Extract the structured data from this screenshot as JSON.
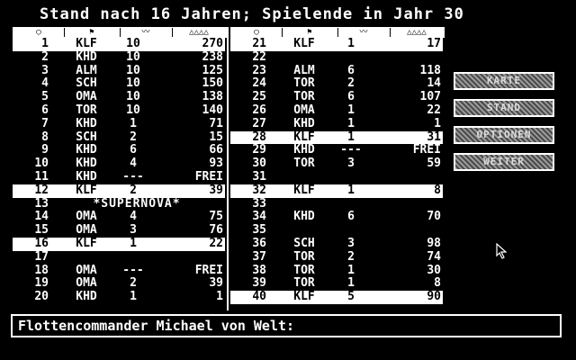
{
  "title": "Stand nach 16 Jahren; Spielende in Jahr 30",
  "header_icons": [
    "circle-icon",
    "flag-icon",
    "wave-icon",
    "triangles-icon"
  ],
  "left_rows": [
    {
      "num": "1",
      "owner": "KLF",
      "ships": "10",
      "prod": "270",
      "hl": true
    },
    {
      "num": "2",
      "owner": "KHD",
      "ships": "10",
      "prod": "238"
    },
    {
      "num": "3",
      "owner": "ALM",
      "ships": "10",
      "prod": "125"
    },
    {
      "num": "4",
      "owner": "SCH",
      "ships": "10",
      "prod": "150"
    },
    {
      "num": "5",
      "owner": "OMA",
      "ships": "10",
      "prod": "138"
    },
    {
      "num": "6",
      "owner": "TOR",
      "ships": "10",
      "prod": "140"
    },
    {
      "num": "7",
      "owner": "KHD",
      "ships": "1",
      "prod": "71"
    },
    {
      "num": "8",
      "owner": "SCH",
      "ships": "2",
      "prod": "15"
    },
    {
      "num": "9",
      "owner": "KHD",
      "ships": "6",
      "prod": "66"
    },
    {
      "num": "10",
      "owner": "KHD",
      "ships": "4",
      "prod": "93"
    },
    {
      "num": "11",
      "owner": "KHD",
      "ships": "---",
      "prod": "FREI"
    },
    {
      "num": "12",
      "owner": "KLF",
      "ships": "2",
      "prod": "39",
      "hl": true
    },
    {
      "num": "13",
      "span": "*SUPERNOVA*"
    },
    {
      "num": "14",
      "owner": "OMA",
      "ships": "4",
      "prod": "75"
    },
    {
      "num": "15",
      "owner": "OMA",
      "ships": "3",
      "prod": "76"
    },
    {
      "num": "16",
      "owner": "KLF",
      "ships": "1",
      "prod": "22",
      "hl": true
    },
    {
      "num": "17",
      "owner": "",
      "ships": "",
      "prod": ""
    },
    {
      "num": "18",
      "owner": "OMA",
      "ships": "---",
      "prod": "FREI"
    },
    {
      "num": "19",
      "owner": "OMA",
      "ships": "2",
      "prod": "39"
    },
    {
      "num": "20",
      "owner": "KHD",
      "ships": "1",
      "prod": "1"
    }
  ],
  "right_rows": [
    {
      "num": "21",
      "owner": "KLF",
      "ships": "1",
      "prod": "17",
      "hl": true
    },
    {
      "num": "22",
      "owner": "",
      "ships": "",
      "prod": ""
    },
    {
      "num": "23",
      "owner": "ALM",
      "ships": "6",
      "prod": "118"
    },
    {
      "num": "24",
      "owner": "TOR",
      "ships": "2",
      "prod": "14"
    },
    {
      "num": "25",
      "owner": "TOR",
      "ships": "6",
      "prod": "107"
    },
    {
      "num": "26",
      "owner": "OMA",
      "ships": "1",
      "prod": "22"
    },
    {
      "num": "27",
      "owner": "KHD",
      "ships": "1",
      "prod": "1"
    },
    {
      "num": "28",
      "owner": "KLF",
      "ships": "1",
      "prod": "31",
      "hl": true
    },
    {
      "num": "29",
      "owner": "KHD",
      "ships": "---",
      "prod": "FREI"
    },
    {
      "num": "30",
      "owner": "TOR",
      "ships": "3",
      "prod": "59"
    },
    {
      "num": "31",
      "owner": "",
      "ships": "",
      "prod": ""
    },
    {
      "num": "32",
      "owner": "KLF",
      "ships": "1",
      "prod": "8",
      "hl": true
    },
    {
      "num": "33",
      "owner": "",
      "ships": "",
      "prod": ""
    },
    {
      "num": "34",
      "owner": "KHD",
      "ships": "6",
      "prod": "70"
    },
    {
      "num": "35",
      "owner": "",
      "ships": "",
      "prod": ""
    },
    {
      "num": "36",
      "owner": "SCH",
      "ships": "3",
      "prod": "98"
    },
    {
      "num": "37",
      "owner": "TOR",
      "ships": "2",
      "prod": "74"
    },
    {
      "num": "38",
      "owner": "TOR",
      "ships": "1",
      "prod": "30"
    },
    {
      "num": "39",
      "owner": "TOR",
      "ships": "1",
      "prod": "8"
    },
    {
      "num": "40",
      "owner": "KLF",
      "ships": "5",
      "prod": "90",
      "hl": true
    }
  ],
  "buttons": {
    "karte": "KARTE",
    "stand": "STAND",
    "optionen": "OPTIONEN",
    "weiter": "WEITER"
  },
  "command": "Flottencommander Michael von Welt:"
}
